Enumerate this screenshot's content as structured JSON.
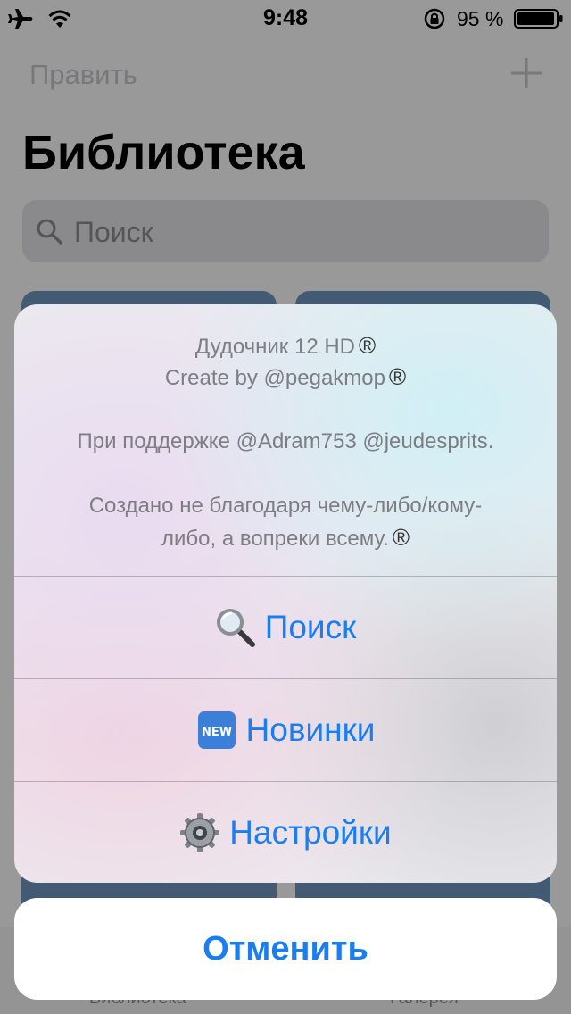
{
  "status_bar": {
    "time": "9:48",
    "battery_percent": "95 %",
    "icons": [
      "airplane-icon",
      "wifi-icon",
      "orientation-lock-icon",
      "battery-icon"
    ]
  },
  "library": {
    "edit_label": "Править",
    "title": "Библиотека",
    "search_placeholder": "Поиск",
    "tabs": [
      {
        "label": "Библиотека"
      },
      {
        "label": "Галерея"
      }
    ]
  },
  "action_sheet": {
    "header_lines": [
      "Дудочник 12 HD",
      "Create by @pegakmop",
      "При поддержке @Adram753 @jeudesprits.",
      "Создано не благодаря чему-либо/кому-",
      "либо, а вопреки всему."
    ],
    "registered_mark": "®",
    "actions": [
      {
        "label": "Поиск",
        "icon": "magnifier-emoji-icon"
      },
      {
        "label": "Новинки",
        "icon": "new-badge-emoji-icon"
      },
      {
        "label": "Настройки",
        "icon": "gear-emoji-icon"
      }
    ],
    "cancel_label": "Отменить"
  },
  "colors": {
    "accent": "#1a7ef0",
    "header_text": "#7d7d82",
    "dim_overlay": "rgba(0,0,0,0.40)"
  }
}
